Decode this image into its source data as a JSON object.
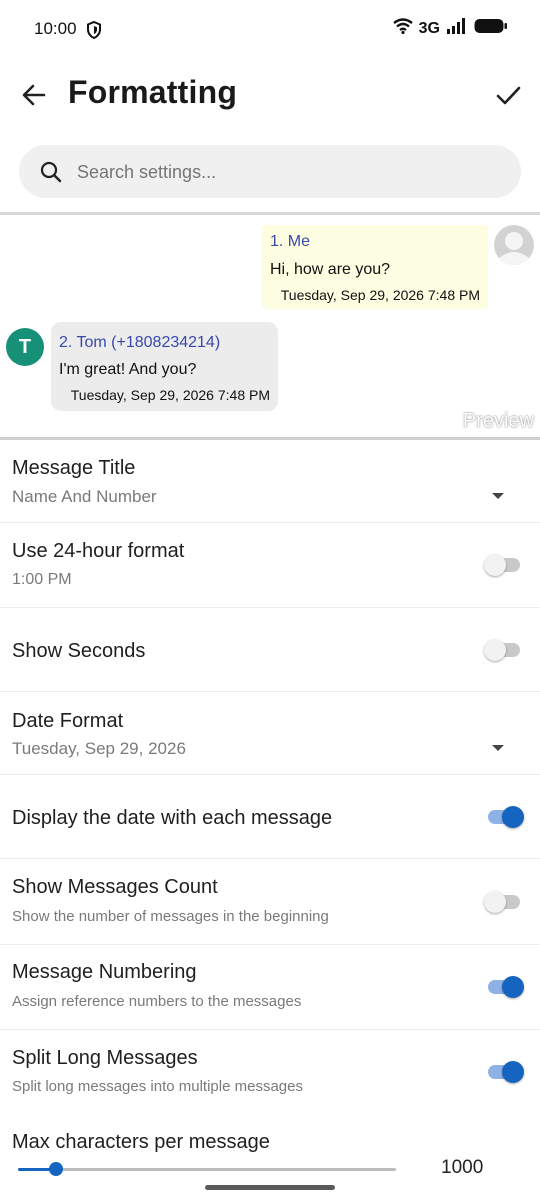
{
  "status_bar": {
    "time": "10:00",
    "network": "3G",
    "icons": [
      "shield-icon",
      "wifi-icon",
      "signal-icon",
      "battery-icon"
    ]
  },
  "appbar": {
    "title": "Formatting",
    "back_icon": "arrow-back-icon",
    "confirm_icon": "check-icon"
  },
  "search": {
    "placeholder": "Search settings..."
  },
  "preview": {
    "me": {
      "title": "1. Me",
      "text": "Hi, how are you?",
      "time": "Tuesday, Sep 29, 2026 7:48 PM"
    },
    "tom": {
      "avatar_letter": "T",
      "title": "2. Tom (+1808234214)",
      "text": "I'm great! And you?",
      "time": "Tuesday, Sep 29, 2026 7:48 PM"
    },
    "label": "Preview"
  },
  "settings": {
    "message_title": {
      "label": "Message Title",
      "value": "Name And Number"
    },
    "use_24h": {
      "label": "Use 24-hour format",
      "sub": "1:00 PM",
      "enabled": false
    },
    "show_seconds": {
      "label": "Show Seconds",
      "enabled": false
    },
    "date_format": {
      "label": "Date Format",
      "value": "Tuesday, Sep 29, 2026"
    },
    "display_date": {
      "label": "Display the date with each message",
      "enabled": true
    },
    "messages_count": {
      "label": "Show Messages Count",
      "desc": "Show the number of messages in the beginning",
      "enabled": false
    },
    "numbering": {
      "label": "Message Numbering",
      "desc": "Assign reference numbers to the messages",
      "enabled": true
    },
    "split_long": {
      "label": "Split Long Messages",
      "desc": "Split long messages into multiple messages",
      "enabled": true
    },
    "max_chars": {
      "label": "Max characters per message",
      "value": "1000",
      "slider_fraction": 0.1
    }
  },
  "colors": {
    "accent": "#1565c0",
    "link_blue": "#3949ab",
    "bubble_me": "#fdfde1",
    "bubble_other": "#ececec",
    "avatar_t": "#179078"
  }
}
